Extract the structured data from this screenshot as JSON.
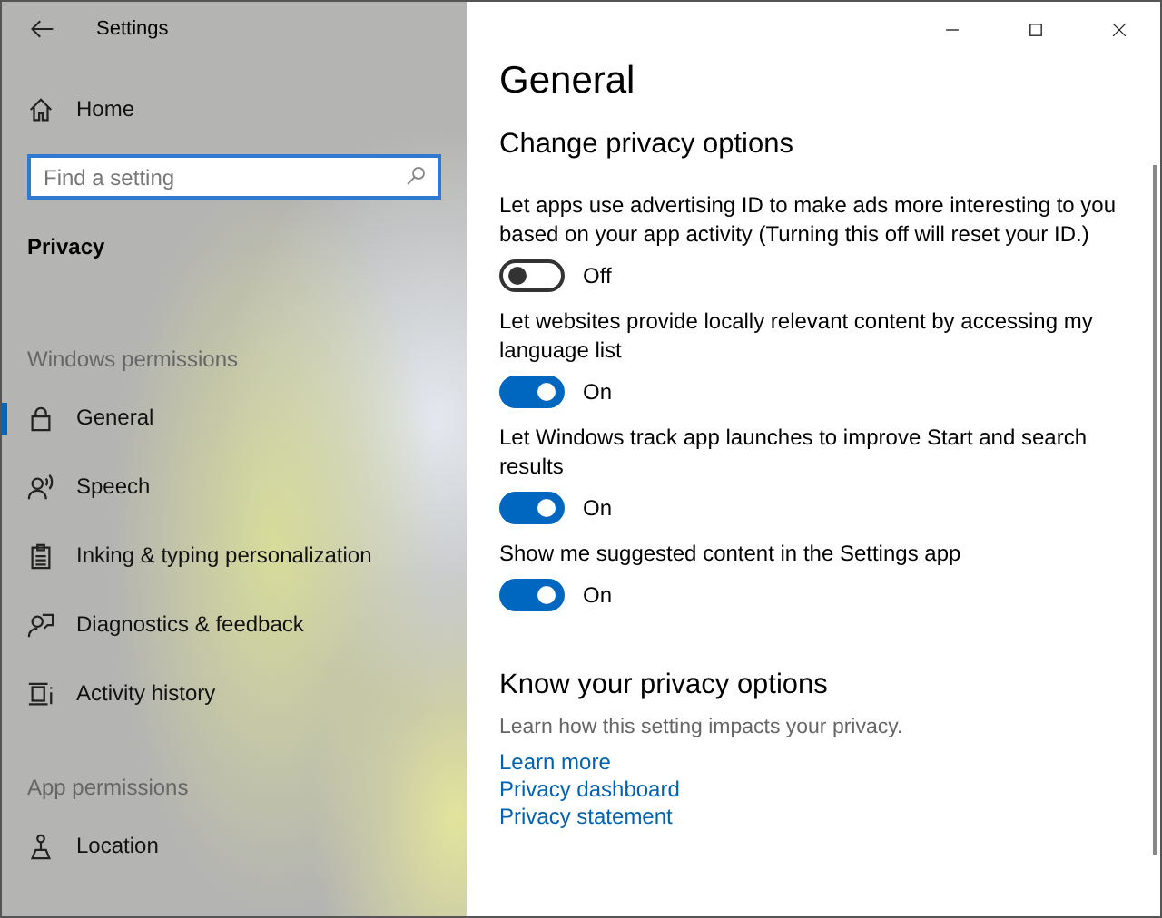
{
  "window": {
    "title": "Settings"
  },
  "sidebar": {
    "home": "Home",
    "search": {
      "placeholder": "Find a setting"
    },
    "section": "Privacy",
    "groups": [
      {
        "heading": "Windows permissions",
        "items": [
          {
            "label": "General",
            "kind": "lock",
            "selected": true
          },
          {
            "label": "Speech",
            "kind": "speech",
            "selected": false
          },
          {
            "label": "Inking & typing personalization",
            "kind": "clipboard",
            "selected": false
          },
          {
            "label": "Diagnostics & feedback",
            "kind": "feedback",
            "selected": false
          },
          {
            "label": "Activity history",
            "kind": "activity",
            "selected": false
          }
        ]
      },
      {
        "heading": "App permissions",
        "items": [
          {
            "label": "Location",
            "kind": "location",
            "selected": false
          }
        ]
      }
    ]
  },
  "page": {
    "title": "General",
    "subtitle": "Change privacy options",
    "options": [
      {
        "label": "Let apps use advertising ID to make ads more interesting to you based on your app activity (Turning this off will reset your ID.)",
        "on": false,
        "state": "Off"
      },
      {
        "label": "Let websites provide locally relevant content by accessing my language list",
        "on": true,
        "state": "On"
      },
      {
        "label": "Let Windows track app launches to improve Start and search results",
        "on": true,
        "state": "On"
      },
      {
        "label": "Show me suggested content in the Settings app",
        "on": true,
        "state": "On"
      }
    ],
    "know": {
      "title": "Know your privacy options",
      "text": "Learn how this setting impacts your privacy.",
      "links": [
        "Learn more",
        "Privacy dashboard",
        "Privacy statement"
      ]
    }
  }
}
